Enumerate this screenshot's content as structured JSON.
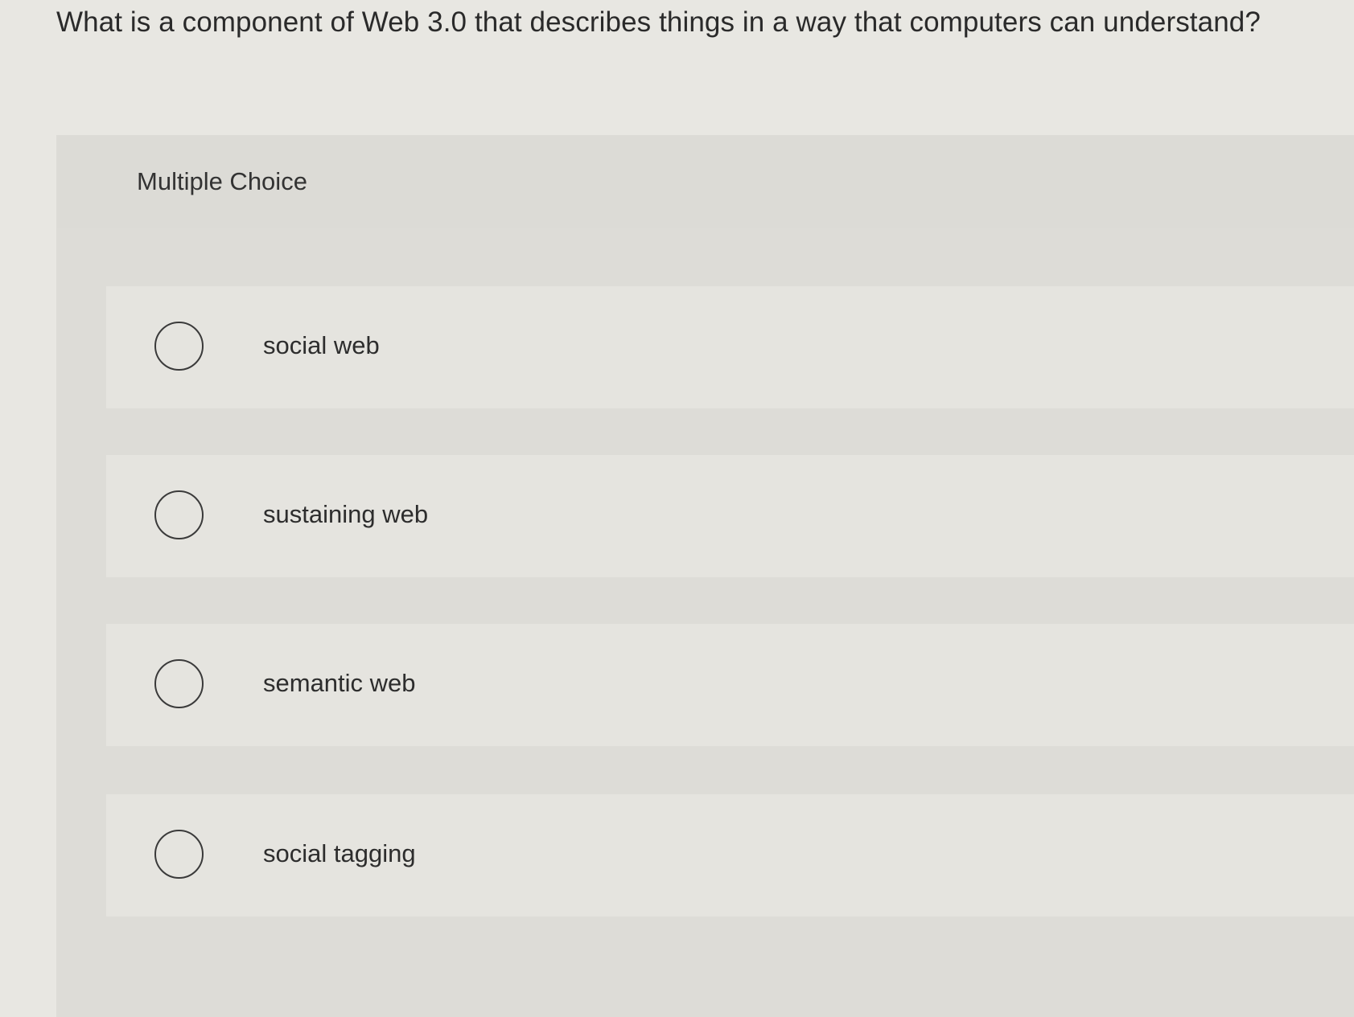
{
  "question": {
    "text": "What is a component of Web 3.0 that describes things in a way that computers can understand?"
  },
  "panel": {
    "label": "Multiple Choice"
  },
  "options": [
    {
      "label": "social web",
      "selected": false
    },
    {
      "label": "sustaining web",
      "selected": false
    },
    {
      "label": "semantic web",
      "selected": false
    },
    {
      "label": "social tagging",
      "selected": false
    }
  ]
}
